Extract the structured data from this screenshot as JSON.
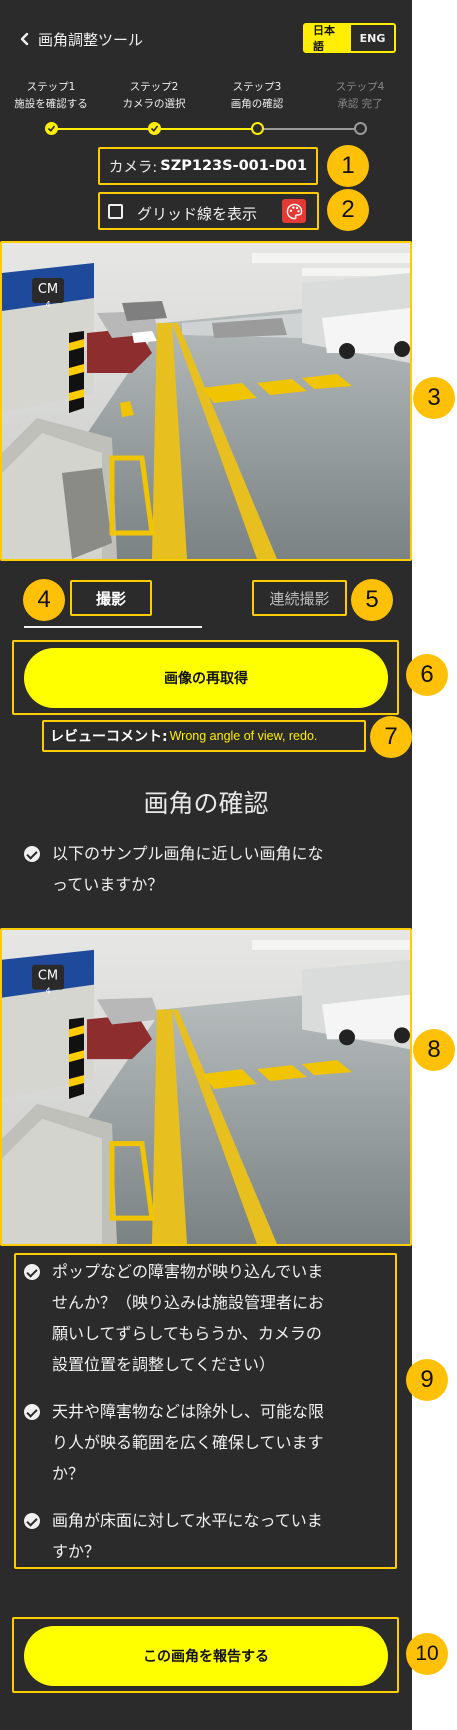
{
  "header": {
    "back_icon": "chevron-left-icon",
    "title": "画角調整ツール"
  },
  "language": {
    "japanese": "日本語",
    "english": "ENG",
    "active": "japanese"
  },
  "steps": [
    {
      "label1": "ステップ1",
      "label2": "施設を確認する",
      "state": "done"
    },
    {
      "label1": "ステップ2",
      "label2": "カメラの選択",
      "state": "done"
    },
    {
      "label1": "ステップ3",
      "label2": "画角の確認",
      "state": "current"
    },
    {
      "label1": "ステップ4",
      "label2": "承認 完了",
      "state": "pending"
    }
  ],
  "camera": {
    "prefix": "カメラ: ",
    "id": "SZP123S-001-D01"
  },
  "grid_toggle": {
    "label": "グリッド線を表示",
    "checked": false,
    "palette_icon": "palette-icon"
  },
  "tabs": {
    "shoot": "撮影",
    "burst": "連続撮影",
    "active": "shoot"
  },
  "retake_button": "画像の再取得",
  "review": {
    "label": "レビューコメント: ",
    "comment": "Wrong angle of view, redo."
  },
  "confirm": {
    "title": "画角の確認",
    "q1_line1": "以下のサンプル画角に近しい画角にな",
    "q1_line2": "っていますか？"
  },
  "checklist": [
    {
      "lines": [
        "ポップなどの障害物が映り込んでいま",
        "せんか？（映り込みは施設管理者にお",
        "願いしてずらしてもらうか、カメラの",
        "設置位置を調整してください）"
      ]
    },
    {
      "lines": [
        "天井や障害物などは除外し、可能な限",
        "り人が映る範囲を広く確保しています",
        "か？"
      ]
    },
    {
      "lines": [
        "画角が床面に対して水平になっていま",
        "すか？"
      ]
    }
  ],
  "report_button": "この画角を報告する",
  "photo": {
    "sign_text": "CM",
    "sign_number": "4"
  },
  "annotations": [
    "1",
    "2",
    "3",
    "4",
    "5",
    "6",
    "7",
    "8",
    "9",
    "10"
  ],
  "colors": {
    "background": "#2b2b2b",
    "accent": "#ffff00",
    "highlight": "#ffcc00",
    "badge": "#ffc107"
  }
}
